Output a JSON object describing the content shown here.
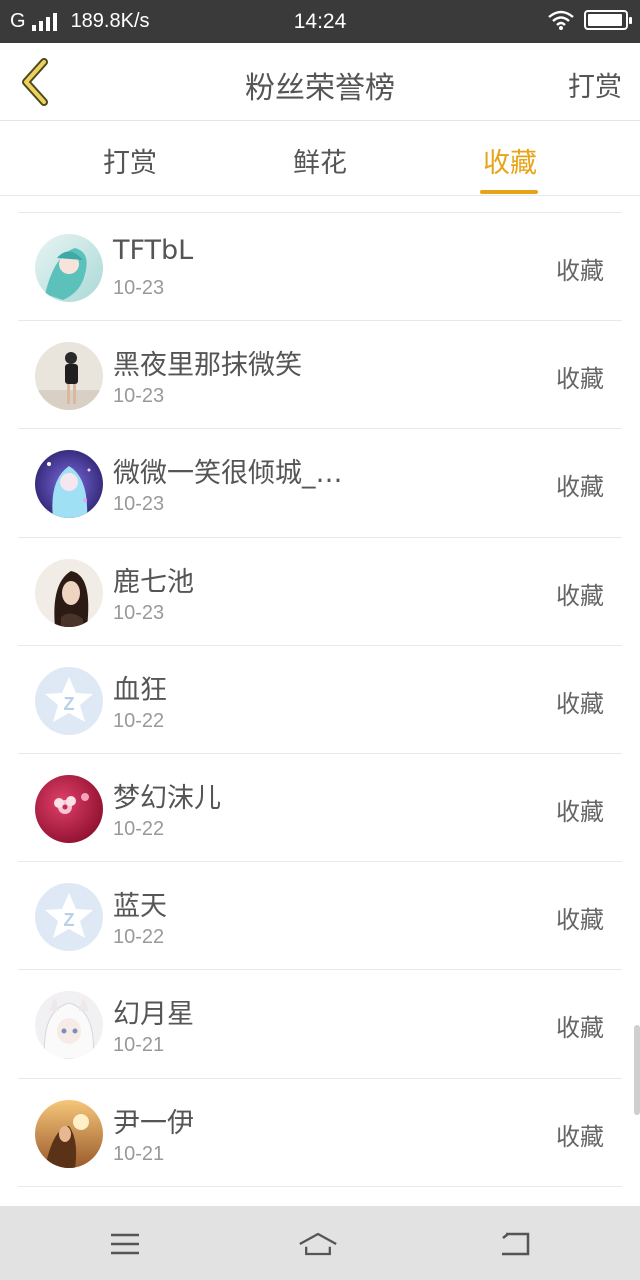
{
  "status_bar": {
    "carrier": "G",
    "speed": "189.8K/s",
    "time": "14:24",
    "battery_level": 0.95,
    "icons": [
      "signal-icon",
      "wifi-icon",
      "battery-icon"
    ]
  },
  "header": {
    "back_icon": "chevron-left-icon",
    "title": "粉丝荣誉榜",
    "action": "打赏"
  },
  "tabs": [
    {
      "label": "打赏",
      "active": false
    },
    {
      "label": "鲜花",
      "active": false
    },
    {
      "label": "收藏",
      "active": true
    }
  ],
  "colors": {
    "accent": "#e8a419",
    "status_bar_bg": "#3a3a3a",
    "nav_bar_bg": "#e2e2e2"
  },
  "fans": [
    {
      "name": "TFTbL",
      "date": "10-23",
      "action": "收藏",
      "avatar": "anime-teal-avatar"
    },
    {
      "name": "黑夜里那抹微笑",
      "date": "10-23",
      "action": "收藏",
      "avatar": "photo-girl-avatar"
    },
    {
      "name": "微微一笑很倾城_…",
      "date": "10-23",
      "action": "收藏",
      "avatar": "anime-purple-avatar"
    },
    {
      "name": "鹿七池",
      "date": "10-23",
      "action": "收藏",
      "avatar": "photo-woman-avatar"
    },
    {
      "name": "血狂",
      "date": "10-22",
      "action": "收藏",
      "avatar": "default-z-avatar"
    },
    {
      "name": "梦幻沫儿",
      "date": "10-22",
      "action": "收藏",
      "avatar": "flower-avatar"
    },
    {
      "name": "蓝天",
      "date": "10-22",
      "action": "收藏",
      "avatar": "default-z-avatar"
    },
    {
      "name": "幻月星",
      "date": "10-21",
      "action": "收藏",
      "avatar": "anime-white-avatar"
    },
    {
      "name": "尹一伊",
      "date": "10-21",
      "action": "收藏",
      "avatar": "photo-sunset-avatar"
    }
  ],
  "nav_bar": {
    "icons": [
      "menu-icon",
      "home-icon",
      "back-icon"
    ]
  }
}
